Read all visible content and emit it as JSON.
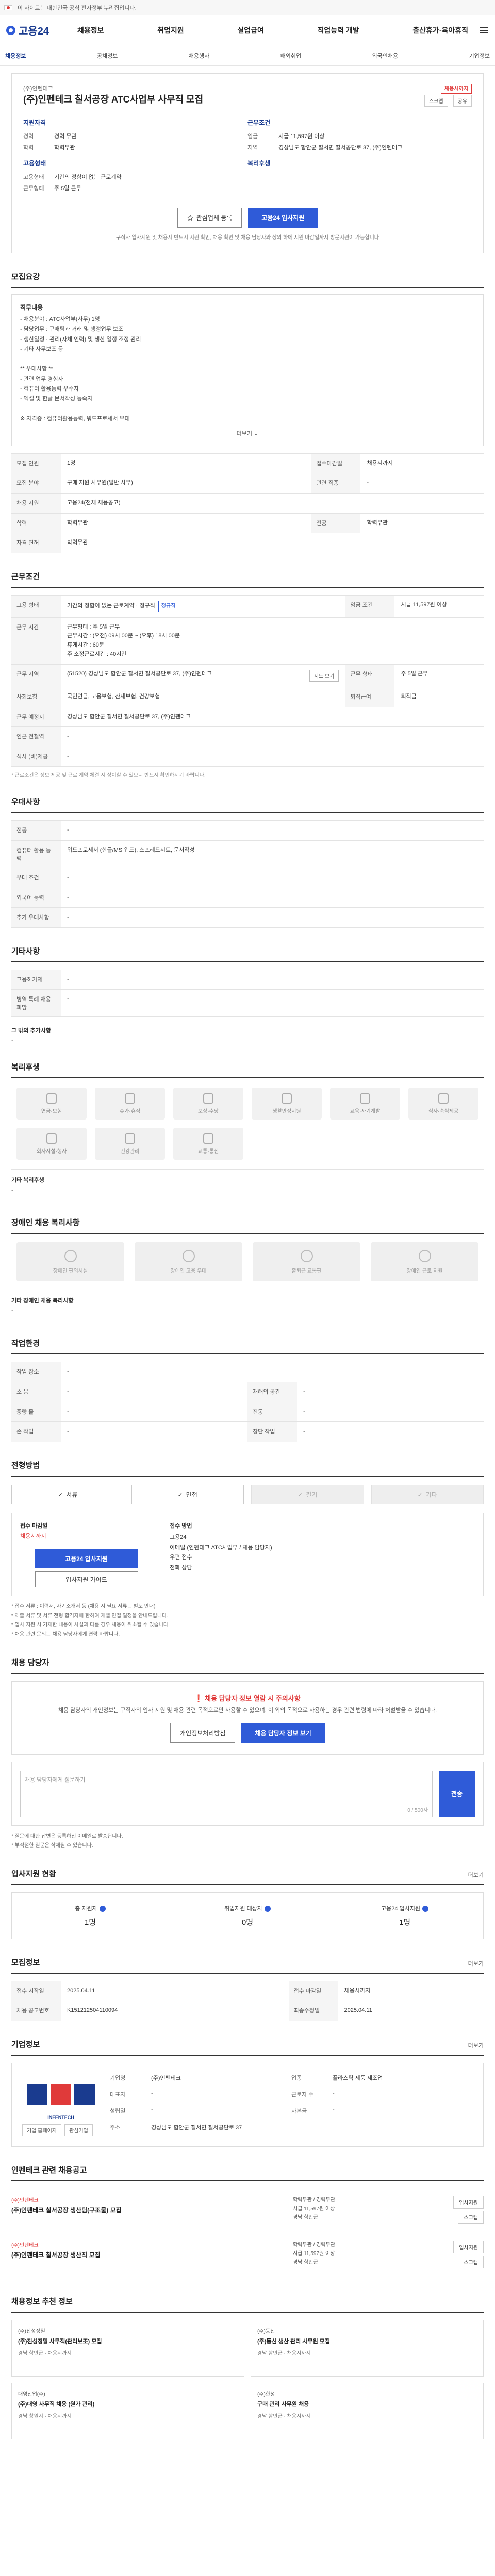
{
  "topbar": {
    "text": "이 사이트는 대한민국 공식 전자정부 누리집입니다."
  },
  "header": {
    "logo": "고용24",
    "menu": [
      "채용정보",
      "취업지원",
      "실업급여",
      "직업능력 개발",
      "출산휴가·육아휴직"
    ]
  },
  "subnav": {
    "items": [
      "채용정보",
      "공채정보",
      "채용행사",
      "해외취업",
      "외국인채용",
      "기업정보"
    ]
  },
  "summary": {
    "company": "(주)인펜테크",
    "title": "(주)인펜테크 칠서공장 ATC사업부 사무직 모집",
    "badge": "채용시까지",
    "scrap_label": "스크랩",
    "share_label": "공유",
    "left_heading": "지원자격",
    "left_rows": [
      {
        "k": "경력",
        "v": "경력 무관"
      },
      {
        "k": "학력",
        "v": "학력무관"
      }
    ],
    "left_heading2": "고용형태",
    "left_rows2": [
      {
        "k": "고용형태",
        "v": "기간의 정함이 없는 근로계약"
      },
      {
        "k": "근무형태",
        "v": "주 5일 근무"
      }
    ],
    "right_heading": "근무조건",
    "right_rows": [
      {
        "k": "임금",
        "v": "시급 11,597원 이상"
      },
      {
        "k": "지역",
        "v": "경상남도 함안군 칠서면 칠서공단로 37, (주)인펜테크"
      }
    ],
    "right_heading2": "복리후생",
    "btn_interest": "관심업체 등록",
    "btn_apply": "고용24 입사지원",
    "note": "구직자 입사지원 및 채용시 반드시 지원 확인, 채용 확인 및 채용 담당자와 상의 하에 지원 마감일까지 방문지원이 가능합니다"
  },
  "recruit": {
    "title": "모집요강",
    "jobdesc_title": "직무내용",
    "jobdesc": "- 채용분야 : ATC사업부(사무) 1명\n- 담당업무 : 구매팀과 거래 및 행정업무 보조\n - 생산일정 · 관리(자체 인력) 및 생산 일정 조정 관리\n - 기타 사무보조 등\n\n** 우대사항 **\n- 관련 업무 경험자\n- 컴퓨터 활용능력 우수자\n- 엑셀 및 한글 문서작성 능숙자\n\n※ 자격증 : 컴퓨터활용능력, 워드프로세서 우대",
    "fold": "더보기",
    "rows": [
      {
        "k": "모집 인원",
        "v": "1명",
        "k2": "접수마감일",
        "v2": "채용시까지"
      },
      {
        "k": "모집 분야",
        "v": "구매 지원 사무원(일반 사무)",
        "k2": "관련 직종",
        "v2": "-"
      },
      {
        "k": "채용 지원",
        "v": "고용24(전체 채용공고)",
        "k2": "",
        "v2": ""
      },
      {
        "k": "학력",
        "v": "학력무관",
        "k2": "전공",
        "v2": "학력무관"
      },
      {
        "k": "자격 면허",
        "v": "학력무관",
        "k2": "",
        "v2": ""
      }
    ]
  },
  "work": {
    "title": "근무조건",
    "rows": [
      {
        "k": "고용 형태",
        "v": "기간의 정함이 없는 근로계약 · 정규직",
        "tag": "정규직",
        "k2": "임금 조건",
        "v2": "시급 11,597원 이상"
      },
      {
        "k": "근무 시간",
        "v": "근무형태 : 주 5일 근무\n근무시간 : (오전) 09시 00분 ~ (오후) 18시 00분\n휴게시간 : 60분\n주 소정근로시간 : 40시간",
        "k2": "",
        "v2": ""
      },
      {
        "k": "근무 지역",
        "v": "(51520) 경상남도 함안군 칠서면 칠서공단로 37, (주)인펜테크",
        "k2": "근무 형태",
        "v2": "주 5일 근무"
      },
      {
        "k": "사회보험",
        "v": "국민연금, 고용보험, 산재보험, 건강보험",
        "k2": "퇴직급여",
        "v2": "퇴직금"
      },
      {
        "k": "근무 예정지",
        "v": "경상남도 함안군 칠서면 칠서공단로 37, (주)인펜테크",
        "k2": "",
        "v2": ""
      },
      {
        "k": "인근 전철역",
        "v": "-",
        "k2": "",
        "v2": ""
      },
      {
        "k": "식사 (비)제공",
        "v": "-",
        "k2": "",
        "v2": ""
      }
    ],
    "map_btn": "지도 보기",
    "footnote": "* 근로조건은 정보 제공 및 근로 계약 체결 시 상이할 수 있으니 반드시 확인하시기 바랍니다."
  },
  "pref": {
    "title": "우대사항",
    "rows": [
      {
        "k": "전공",
        "v": "-"
      },
      {
        "k": "컴퓨터 활용 능력",
        "v": "워드프로세서 (한글/MS 워드), 스프레드시트, 문서작성"
      },
      {
        "k": "우대 조건",
        "v": "-"
      },
      {
        "k": "외국어 능력",
        "v": "-"
      },
      {
        "k": "추가 우대사항",
        "v": "-"
      }
    ]
  },
  "other": {
    "title": "기타사항",
    "rows": [
      {
        "k": "고용허가제",
        "v": "-"
      },
      {
        "k": "병역 특례 채용 희망",
        "v": "-"
      }
    ],
    "sub": "그 밖의 추가사항",
    "sub_v": "-"
  },
  "welfare": {
    "title": "복리후생",
    "items": [
      "연금·보험",
      "휴가·휴직",
      "보상·수당",
      "생활안정지원",
      "교육·자기계발",
      "식사·숙식제공",
      "회사시설·행사",
      "건강관리",
      "교통·통신"
    ],
    "extra_title": "기타 복리후생",
    "extra_v": "-"
  },
  "disability": {
    "title": "장애인 채용 복리사항",
    "items": [
      "장애인 편의시설",
      "장애인 고용 우대",
      "출퇴근 교통편",
      "장애인 근로 지원"
    ],
    "extra_title": "기타 장애인 채용 복리사항",
    "extra_v": "-"
  },
  "workenv": {
    "title": "작업환경",
    "rows": [
      {
        "k": "작업 장소",
        "v": "-",
        "k2": "",
        "v2": ""
      },
      {
        "k": "소 음",
        "v": "-",
        "k2": "재해의 공간",
        "v2": "-"
      },
      {
        "k": "중량 물",
        "v": "-",
        "k2": "진동",
        "v2": "-"
      },
      {
        "k": "손 작업",
        "v": "-",
        "k2": "장단 작업",
        "v2": "-"
      }
    ]
  },
  "method": {
    "title": "전형방법",
    "tabs": [
      {
        "label": "서류",
        "dim": false
      },
      {
        "label": "면접",
        "dim": false
      },
      {
        "label": "필기",
        "dim": true
      },
      {
        "label": "기타",
        "dim": true
      }
    ],
    "apply_label": "접수 마감일",
    "apply_period": "채용시까지",
    "apply_btn": "고용24 입사지원",
    "apply_btn2": "입사지원 가이드",
    "right_label": "접수 방법",
    "right_lines": [
      "고용24",
      "이메일 (인펜테크 ATC사업부 / 채용 담당자)",
      "우편 접수",
      "전화 상담"
    ],
    "notes": [
      "* 접수 서류 : 이력서, 자기소개서 등 (채용 시 필요 서류는 별도 안내)",
      "* 제출 서류 및 서류 전형 합격자에 한하여 개별 면접 일정을 안내드립니다.",
      "* 입사 지원 시 기재한 내용이 사실과 다를 경우 채용이 취소될 수 있습니다.",
      "* 채용 관련 문의는 채용 담당자에게 연락 바랍니다."
    ]
  },
  "consult": {
    "title": "채용 담당자",
    "warn": "채용 담당자 정보 열람 시 주의사항",
    "desc": "채용 담당자의 개인정보는 구직자의 입사 지원 및 채용 관련 목적으로만 사용할 수 있으며, 이 외의 목적으로 사용하는 경우 관련 법령에 따라 처벌받을 수 있습니다.",
    "btn1": "채용 담당자 정보 보기",
    "btn2": "개인정보처리방침"
  },
  "qa": {
    "placeholder": "채용 담당자에게 질문하기",
    "count": "0 / 500자",
    "send": "전송",
    "notes": [
      "* 질문에 대한 답변은 등록하신 이메일로 발송됩니다.",
      "* 부적절한 질문은 삭제될 수 있습니다."
    ]
  },
  "stats": {
    "title": "입사지원 현황",
    "more": "더보기",
    "items": [
      {
        "lb": "총 지원자",
        "val": "1명"
      },
      {
        "lb": "취업지원 대상자",
        "val": "0명"
      },
      {
        "lb": "고용24 입사지원",
        "val": "1명"
      }
    ]
  },
  "info": {
    "title": "모집정보",
    "more": "더보기",
    "rows": [
      {
        "k": "접수 시작일",
        "v": "2025.04.11",
        "k2": "접수 마감일",
        "v2": "채용시까지"
      },
      {
        "k": "채용 공고번호",
        "v": "K151212504110094",
        "k2": "최종수정일",
        "v2": "2025.04.11"
      }
    ]
  },
  "company": {
    "title": "기업정보",
    "more": "더보기",
    "logo_text": "INFENTECH",
    "btn1": "기업 홈페이지",
    "btn2": "관심기업",
    "rows": [
      {
        "k": "기업명",
        "v": "(주)인펜테크",
        "k2": "업종",
        "v2": "플라스틱 제품 제조업"
      },
      {
        "k": "대표자",
        "v": "-",
        "k2": "근로자 수",
        "v2": "-"
      },
      {
        "k": "설립일",
        "v": "-",
        "k2": "자본금",
        "v2": "-"
      },
      {
        "k": "주소",
        "v": "경상남도 함안군 칠서면 칠서공단로 37",
        "k2": "",
        "v2": ""
      }
    ]
  },
  "related": {
    "title": "인펜테크 관련 채용공고",
    "items": [
      {
        "co": "(주)인펜테크",
        "t": "(주)인펜테크 칠서공장 생산팀(구조물) 모집",
        "m1": "학력무관 / 경력무관",
        "m2": "시급 11,597원 이상",
        "m3": "경남 함안군"
      },
      {
        "co": "(주)인펜테크",
        "t": "(주)인펜테크 칠서공장 생산직 모집",
        "m1": "학력무관 / 경력무관",
        "m2": "시급 11,597원 이상",
        "m3": "경남 함안군"
      }
    ],
    "btn1": "입사지원",
    "btn2": "스크랩"
  },
  "recommend": {
    "title": "채용정보 추천 정보",
    "cards": [
      {
        "co": "(주)진성정밀",
        "t": "(주)진성정밀 사무직(관리보조) 모집",
        "m": "경남 함안군 · 채용시까지"
      },
      {
        "co": "(주)동신",
        "t": "(주)동신 생산 관리 사무원 모집",
        "m": "경남 함안군 · 채용시까지"
      },
      {
        "co": "대영산업(주)",
        "t": "(주)대영 사무직 채용 (원가 관리)",
        "m": "경남 창원시 · 채용시까지"
      },
      {
        "co": "(주)한성",
        "t": "구매 관리 사무원 채용",
        "m": "경남 함안군 · 채용시까지"
      }
    ]
  }
}
